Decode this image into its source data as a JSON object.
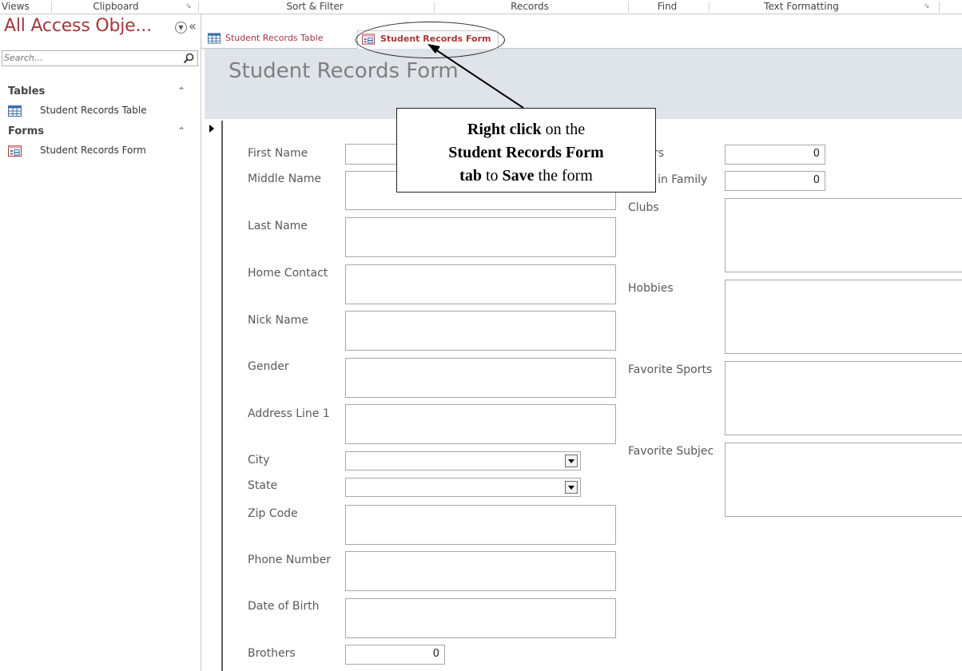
{
  "ribbon": {
    "groups": [
      "Views",
      "Clipboard",
      "Sort & Filter",
      "Records",
      "Find",
      "Text Formatting"
    ]
  },
  "nav": {
    "title": "All Access Obje...",
    "search_placeholder": "Search...",
    "groups": [
      {
        "label": "Tables",
        "items": [
          "Student Records Table"
        ]
      },
      {
        "label": "Forms",
        "items": [
          "Student Records Form"
        ]
      }
    ]
  },
  "tabs": [
    "Student Records Table",
    "Student Records Form"
  ],
  "form": {
    "title": "Student Records Form",
    "left_fields": {
      "first_name": "First Name",
      "middle_name": "Middle Name",
      "last_name": "Last Name",
      "home_contact": "Home Contact",
      "nick_name": "Nick Name",
      "gender": "Gender",
      "address_line_1": "Address Line 1",
      "city": "City",
      "state": "State",
      "zip_code": "Zip Code",
      "phone_number": "Phone Number",
      "date_of_birth": "Date of Birth",
      "brothers": "Brothers"
    },
    "brothers_value": "0",
    "right_fields": {
      "sisters_partial": "rs",
      "place_in_family_partial": "e in Family",
      "clubs": "Clubs",
      "hobbies": "Hobbies",
      "favorite_sports": "Favorite Sports",
      "favorite_subject": "Favorite Subjec"
    },
    "sisters_value": "0",
    "place_in_family_value": "0"
  },
  "callout": {
    "line1_bold": "Right click",
    "line1_rest": " on the",
    "line2_bold": "Student Records Form",
    "line3_bold_a": "tab",
    "line3_mid": " to ",
    "line3_bold_b": "Save",
    "line3_rest": " the form"
  },
  "colors": {
    "access_red": "#a4373a",
    "header_band": "#dfe3ea"
  }
}
